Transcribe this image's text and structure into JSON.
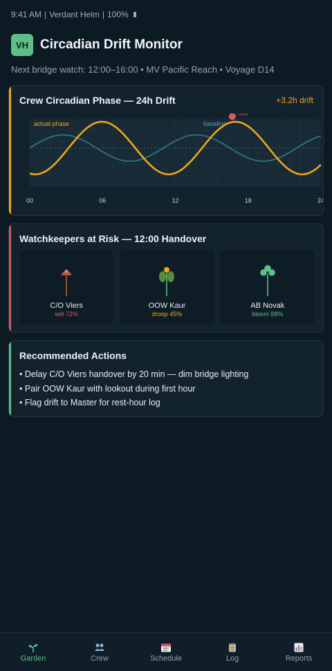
{
  "status": {
    "time": "9:41 AM",
    "carrier": "Verdant Helm",
    "battery": "100%"
  },
  "app": {
    "avatar": "VH",
    "title": "Circadian Drift Monitor",
    "subtitle": "Next bridge watch: 12:00–16:00 • MV Pacific Reach • Voyage D14"
  },
  "drift_card": {
    "title": "Crew Circadian Phase — 24h Drift",
    "badge": "+3.2h drift",
    "accent_color": "#f2a51c"
  },
  "chart_data": {
    "type": "line",
    "x_ticks": [
      "00",
      "06",
      "12",
      "18",
      "24"
    ],
    "xlim": [
      0,
      24
    ],
    "series": [
      {
        "name": "actual phase",
        "color": "#f2a51c",
        "period_h": 11,
        "amplitude": 1.0,
        "phase_shift_h": 3.2
      },
      {
        "name": "baseline",
        "color": "#2f6e78",
        "period_h": 11,
        "amplitude": 0.5,
        "phase_shift_h": 0
      }
    ],
    "marker": {
      "label": "now",
      "x": 16.7,
      "color": "#d75a67"
    },
    "grid": true
  },
  "risk_card": {
    "title": "Watchkeepers at Risk — 12:00 Handover",
    "accent_color": "#d75a67",
    "crew": [
      {
        "name": "C/O Viers",
        "state": "wilt 72%",
        "state_color": "#d75a67",
        "icon": "wilted-plant-icon"
      },
      {
        "name": "OOW Kaur",
        "state": "droop 45%",
        "state_color": "#f2a51c",
        "icon": "drooping-plant-icon"
      },
      {
        "name": "AB Novak",
        "state": "bloom 88%",
        "state_color": "#5dbf86",
        "icon": "blooming-plant-icon"
      }
    ]
  },
  "actions_card": {
    "title": "Recommended Actions",
    "accent_color": "#5dbf86",
    "items": [
      "• Delay C/O Viers handover by 20 min — dim bridge lighting",
      "• Pair OOW Kaur with lookout during first hour",
      "• Flag drift to Master for rest-hour log"
    ]
  },
  "nav": {
    "items": [
      {
        "label": "Garden",
        "icon": "sprout-icon",
        "active": true
      },
      {
        "label": "Crew",
        "icon": "people-icon",
        "active": false
      },
      {
        "label": "Schedule",
        "icon": "calendar-icon",
        "active": false
      },
      {
        "label": "Log",
        "icon": "clipboard-icon",
        "active": false
      },
      {
        "label": "Reports",
        "icon": "bar-chart-icon",
        "active": false
      }
    ]
  }
}
